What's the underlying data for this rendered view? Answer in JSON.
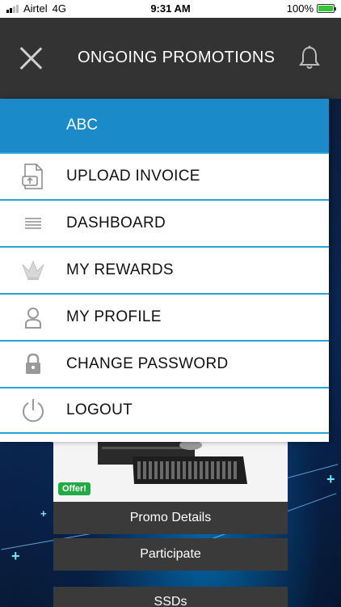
{
  "status_bar": {
    "carrier": "Airtel",
    "network": "4G",
    "time": "9:31 AM",
    "battery": "100%"
  },
  "header": {
    "title": "ONGOING PROMOTIONS",
    "close_icon": "close-icon",
    "bell_icon": "bell-icon"
  },
  "drawer": {
    "user_name": "ABC",
    "items": [
      {
        "label": "UPLOAD INVOICE",
        "icon": "upload-invoice-icon"
      },
      {
        "label": "DASHBOARD",
        "icon": "list-icon"
      },
      {
        "label": "MY REWARDS",
        "icon": "crown-icon"
      },
      {
        "label": "MY PROFILE",
        "icon": "user-icon"
      },
      {
        "label": "CHANGE PASSWORD",
        "icon": "lock-icon"
      },
      {
        "label": "LOGOUT",
        "icon": "power-icon"
      }
    ]
  },
  "promo": {
    "badge": "Offer!",
    "details_label": "Promo Details",
    "participate_label": "Participate",
    "category_label": "SSDs"
  },
  "colors": {
    "header": "#333333",
    "drawer_head": "#1a8ac9",
    "divider": "#2aa3d6",
    "offer": "#22aa44"
  }
}
